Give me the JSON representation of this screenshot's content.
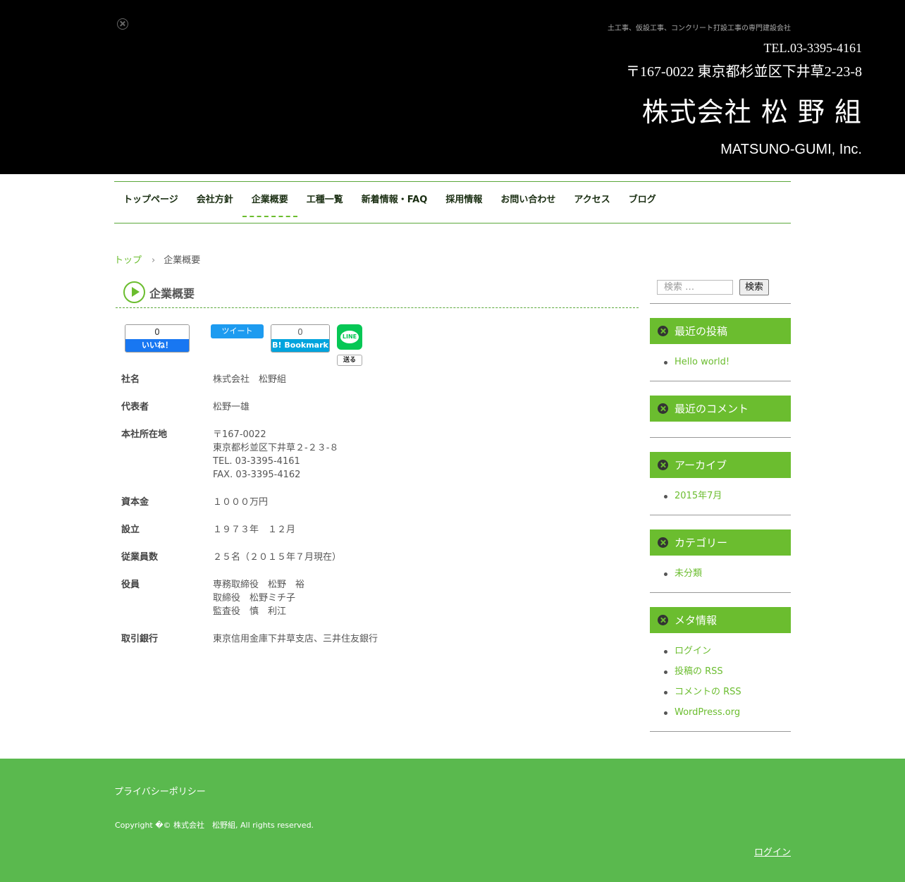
{
  "header": {
    "tagline": "土工事、仮設工事、コンクリート打設工事の専門建設会社",
    "tel": "TEL.03-3395-4161",
    "address": "〒167-0022 東京都杉並区下井草2-23-8",
    "company_name": "株式会社 松 野 組",
    "company_name_en": "MATSUNO-GUMI, Inc."
  },
  "nav": {
    "items": [
      "トップページ",
      "会社方針",
      "企業概要",
      "工種一覧",
      "新着情報・FAQ",
      "採用情報",
      "お問い合わせ",
      "アクセス",
      "ブログ"
    ],
    "current_index": 2
  },
  "breadcrumb": {
    "home": "トップ",
    "separator": "›",
    "current": "企業概要"
  },
  "page": {
    "title": "企業概要"
  },
  "share": {
    "fb_count": "0",
    "fb_label": "いいね！",
    "tweet_label": "ツイート",
    "hatena_count": "0",
    "hatena_label": "B! Bookmark",
    "line_icon_text": "LINE",
    "line_send": "送る"
  },
  "company_info": [
    {
      "key": "社名",
      "lines": [
        "株式会社　松野組"
      ]
    },
    {
      "key": "代表者",
      "lines": [
        "松野一雄"
      ]
    },
    {
      "key": "本社所在地",
      "lines": [
        "〒167-0022",
        "東京都杉並区下井草２-２３-８",
        "TEL. 03-3395-4161",
        "FAX. 03-3395-4162"
      ]
    },
    {
      "key": "資本金",
      "lines": [
        "１０００万円"
      ]
    },
    {
      "key": "設立",
      "lines": [
        "１９７３年　１２月"
      ]
    },
    {
      "key": "従業員数",
      "lines": [
        "２５名（２０１５年７月現在）"
      ]
    },
    {
      "key": "役員",
      "lines": [
        "専務取締役　松野　裕",
        "取締役　松野ミチ子",
        "監査役　慎　利江"
      ]
    },
    {
      "key": "取引銀行",
      "lines": [
        "東京信用金庫下井草支店、三井住友銀行"
      ]
    }
  ],
  "sidebar": {
    "search_placeholder": "検索 …",
    "search_button": "検索",
    "widgets": [
      {
        "title": "最近の投稿",
        "items": [
          "Hello world!"
        ]
      },
      {
        "title": "最近のコメント",
        "items": []
      },
      {
        "title": "アーカイブ",
        "items": [
          "2015年7月"
        ]
      },
      {
        "title": "カテゴリー",
        "items": [
          "未分類"
        ]
      },
      {
        "title": "メタ情報",
        "items": [
          "ログイン",
          "投稿の RSS",
          "コメントの RSS",
          "WordPress.org"
        ]
      }
    ]
  },
  "footer": {
    "privacy": "プライバシーポリシー",
    "copyright": "Copyright �© 株式会社　松野組, All rights reserved.",
    "login": "ログイン"
  },
  "colors": {
    "accent": "#6bbd2f",
    "footer_bg": "#5ab94e",
    "header_bg": "#000000",
    "nav_border": "#5aa83a"
  }
}
